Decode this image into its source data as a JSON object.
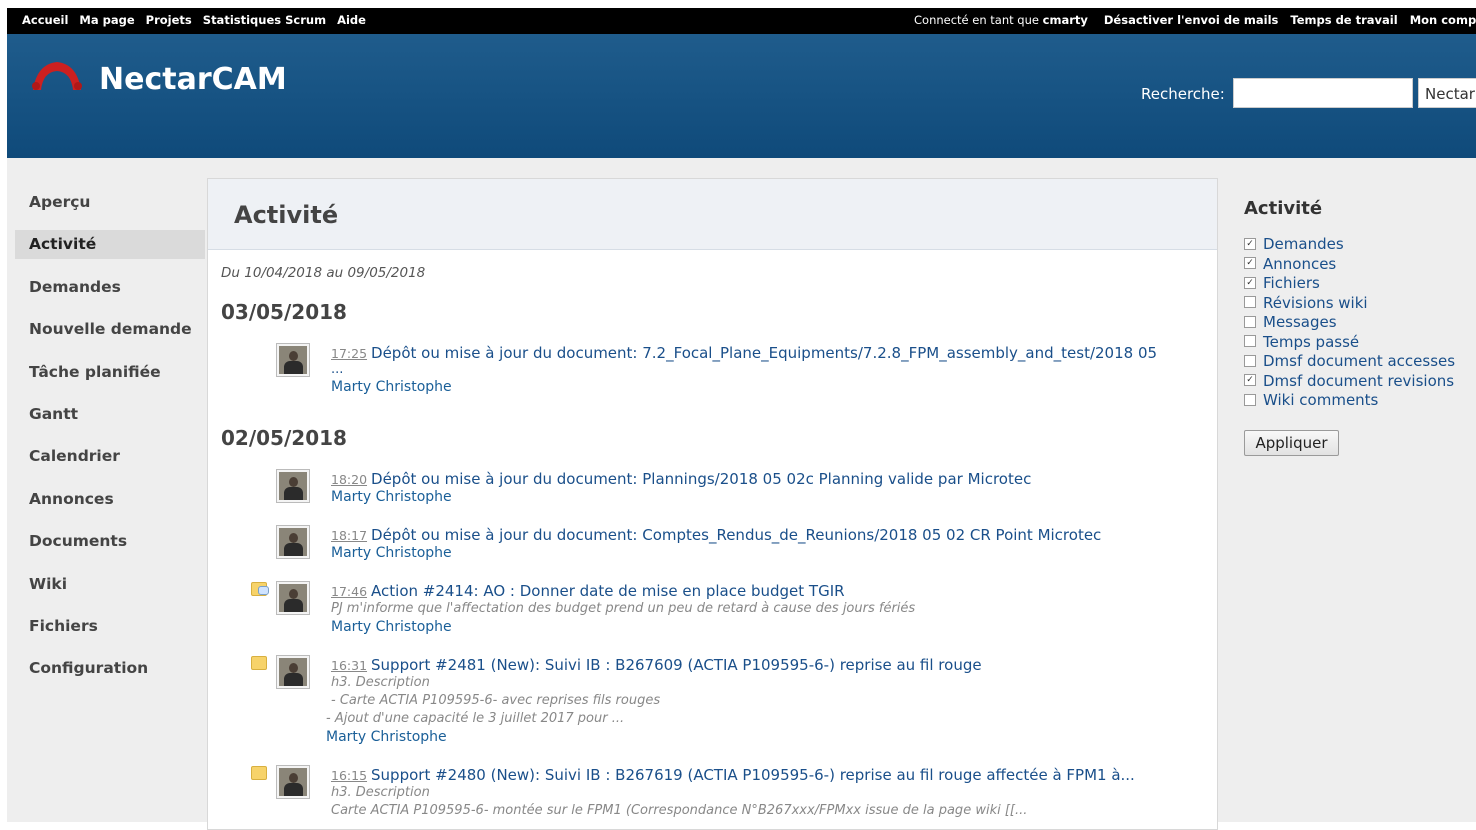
{
  "top_menu": {
    "left": [
      "Accueil",
      "Ma page",
      "Projets",
      "Statistiques Scrum",
      "Aide"
    ],
    "logged_prefix": "Connecté en tant que ",
    "user": "cmarty",
    "right": [
      "Désactiver l'envoi de mails",
      "Temps de travail",
      "Mon comp"
    ]
  },
  "header": {
    "title": "NectarCAM",
    "search_label": "Recherche:",
    "search_value": "",
    "project_select": "Nectar"
  },
  "nav": {
    "items": [
      "Aperçu",
      "Activité",
      "Demandes",
      "Nouvelle demande",
      "Tâche planifiée",
      "Gantt",
      "Calendrier",
      "Annonces",
      "Documents",
      "Wiki",
      "Fichiers",
      "Configuration"
    ],
    "selected": "Activité"
  },
  "content": {
    "title": "Activité",
    "date_range": "Du 10/04/2018 au 09/05/2018",
    "days": [
      {
        "date": "03/05/2018",
        "events": [
          {
            "time": "17:25",
            "title": "Dépôt ou mise à jour du document: 7.2_Focal_Plane_Equipments/7.2.8_FPM_assembly_and_test/2018 05",
            "desc": [
              "..."
            ],
            "author": "Marty Christophe"
          }
        ]
      },
      {
        "date": "02/05/2018",
        "events": [
          {
            "time": "18:20",
            "title": "Dépôt ou mise à jour du document: Plannings/2018 05 02c Planning valide par Microtec",
            "author": "Marty Christophe"
          },
          {
            "time": "18:17",
            "title": "Dépôt ou mise à jour du document: Comptes_Rendus_de_Reunions/2018 05 02 CR Point Microtec",
            "author": "Marty Christophe"
          },
          {
            "time": "17:46",
            "title": "Action #2414: AO : Donner date de mise en place budget TGIR",
            "desc": [
              "PJ m'informe que l'affectation des budget prend un peu de retard à cause des jours fériés"
            ],
            "author": "Marty Christophe",
            "icon": "comment-icon"
          },
          {
            "time": "16:31",
            "title": "Support #2481 (New): Suivi IB : B267609 (ACTIA P109595-6-) reprise au fil rouge",
            "desc": [
              "h3. Description",
              "- Carte ACTIA P109595-6- avec reprises fils rouges",
              "- Ajout d'une capacité le 3 juillet 2017 pour ..."
            ],
            "author": "Marty Christophe",
            "icon": "issue-icon"
          },
          {
            "time": "16:15",
            "title": "Support #2480 (New): Suivi IB : B267619 (ACTIA P109595-6-) reprise au fil rouge affectée à FPM1 à...",
            "desc": [
              "h3. Description",
              "Carte ACTIA P109595-6- montée sur le FPM1 (Correspondance N°B267xxx/FPMxx issue de la page wiki [[..."
            ],
            "icon": "issue-icon"
          }
        ]
      }
    ]
  },
  "sidebar": {
    "title": "Activité",
    "filters": [
      {
        "label": "Demandes",
        "checked": true
      },
      {
        "label": "Annonces",
        "checked": true
      },
      {
        "label": "Fichiers",
        "checked": true
      },
      {
        "label": "Révisions wiki",
        "checked": false
      },
      {
        "label": "Messages",
        "checked": false
      },
      {
        "label": "Temps passé",
        "checked": false
      },
      {
        "label": "Dmsf document accesses",
        "checked": false
      },
      {
        "label": "Dmsf document revisions",
        "checked": true
      },
      {
        "label": "Wiki comments",
        "checked": false
      }
    ],
    "apply_label": "Appliquer"
  },
  "colors": {
    "header_bg": "#15578a",
    "link": "#1a4f8a",
    "top_menu_bg": "#000000"
  }
}
